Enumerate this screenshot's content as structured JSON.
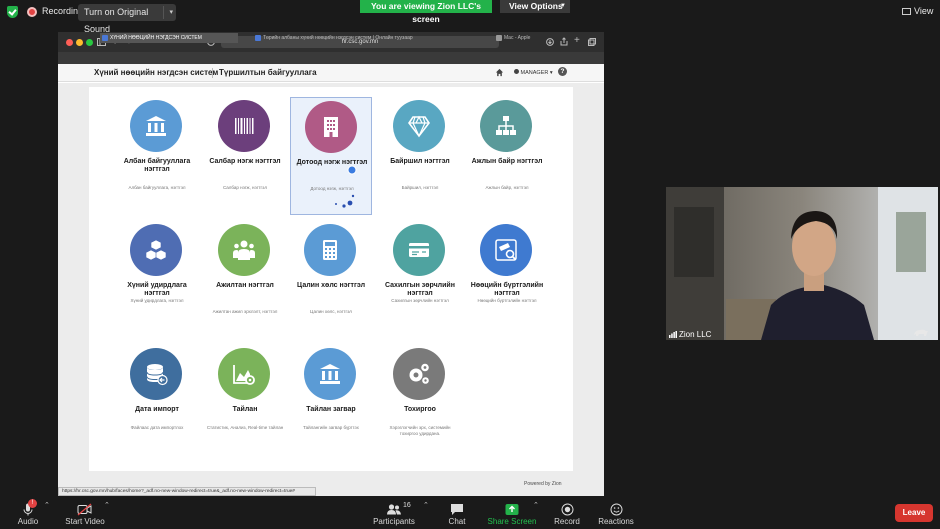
{
  "zoom_top": {
    "recording_label": "Recording",
    "original_sound_label": "Turn on Original Sound",
    "viewing_label": "You are viewing Zion LLC's screen",
    "view_options_label": "View Options",
    "view_label": "View"
  },
  "browser": {
    "url": "hr.csc.gov.mn",
    "tabs": [
      "ХҮНИЙ НӨӨЦИЙН НЭГДСЭН СИСТЕМ",
      "Төрийн албаны хүний нөөцийн нэгдсэн систем | Онлайн туузаар",
      "Mac - Apple"
    ],
    "status_url": "https://hr.csc.gov.mn/hub/faces/home?_adf.no-new-window-redirect=true&_adf.no-new-window-redirect=true#"
  },
  "app": {
    "title": "Хүний нөөцийн нэгдсэн систем",
    "subtitle": "Түршилтын байгууллага",
    "user": "MANAGER",
    "powered_by": "Powered by Zion"
  },
  "cards": [
    {
      "title": "Албан байгууллага нэгтгэл",
      "desc": "Албан байгууллага, нэгтгэл",
      "color": "#5b9bd5",
      "icon": "institution-icon"
    },
    {
      "title": "Салбар нэгж нэгтгэл",
      "desc": "Салбар нэгж, нэгтгэл",
      "color": "#6c3f7c",
      "icon": "barcode-icon"
    },
    {
      "title": "Дотоод нэгж нэгтгэл",
      "desc": "Дотоод нэгж, нэгтгэл",
      "color": "#b05a86",
      "icon": "building-icon"
    },
    {
      "title": "Байршил нэгтгэл",
      "desc": "Байршил, нэгтгэл",
      "color": "#59a7c2",
      "icon": "diamond-icon"
    },
    {
      "title": "Ажлын байр нэгтгэл",
      "desc": "Ажлын байр, нэгтгэл",
      "color": "#5a9a9a",
      "icon": "org-chart-icon"
    },
    {
      "title": "Хүний удирдлага нэгтгэл",
      "desc": "Хүний удирдлага, нэгтгэл",
      "color": "#4f6db3",
      "icon": "cubes-icon"
    },
    {
      "title": "Ажилтан нэгтгэл",
      "desc": "Ажилтан ажил эрхлэлт, нэгтгэл",
      "color": "#7bb35a",
      "icon": "staff-icon"
    },
    {
      "title": "Цалин хөлс нэгтгэл",
      "desc": "Цалин хөлс, нэгтгэл",
      "color": "#5b9bd5",
      "icon": "calculator-icon"
    },
    {
      "title": "Сахилгын зөрчлийн нэгтгэл",
      "desc": "Сахилгын зөрчлийн нэгтгэл",
      "color": "#4fa3a0",
      "icon": "card-icon"
    },
    {
      "title": "Нөөцийн бүртгэлийн нэгтгэл",
      "desc": "Нөөцийн бүртгэлийн нэгтгэл",
      "color": "#3f7ad0",
      "icon": "telescope-icon"
    },
    {
      "title": "Дата импорт",
      "desc": "Файлаас дата импортлох",
      "color": "#3f6e9e",
      "icon": "database-import-icon"
    },
    {
      "title": "Тайлан",
      "desc": "Статистик, Анализ, Real-time тайлан",
      "color": "#7bb35a",
      "icon": "chart-gear-icon"
    },
    {
      "title": "Тайлан загвар",
      "desc": "Тайлангийн загвар бүртгэх",
      "color": "#5b9bd5",
      "icon": "institution-icon"
    },
    {
      "title": "Тохиргоо",
      "desc": "Хэрэглэгчийн эрх, системийн тохиргоо удирдана.",
      "color": "#7a7a7a",
      "icon": "gears-icon"
    }
  ],
  "video": {
    "name": "Zion LLC"
  },
  "toolbar": {
    "audio": "Audio",
    "video": "Start Video",
    "participants": "Participants",
    "participants_count": "16",
    "chat": "Chat",
    "share": "Share Screen",
    "record": "Record",
    "reactions": "Reactions",
    "leave": "Leave",
    "audio_badge": "!"
  }
}
